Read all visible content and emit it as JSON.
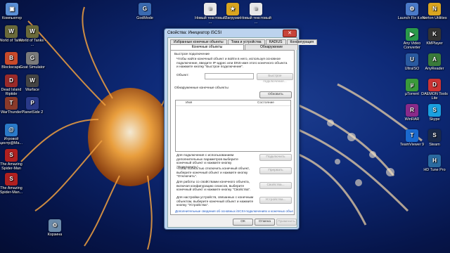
{
  "desktop": {
    "icons_left": [
      {
        "label": "Компьютер",
        "glyph": "▣",
        "color": "#5a8fd6"
      },
      {
        "label": "World of Tanks",
        "glyph": "W",
        "color": "#6a6a3a"
      },
      {
        "label": "World of Tanks - ...",
        "glyph": "W",
        "color": "#6a6a3a"
      },
      {
        "label": "Blockscape",
        "glyph": "B",
        "color": "#c94a2a"
      },
      {
        "label": "Goat Simulator",
        "glyph": "G",
        "color": "#7a7a7a"
      },
      {
        "label": "Dead Island Riptide",
        "glyph": "D",
        "color": "#9a2a2a"
      },
      {
        "label": "Warface",
        "glyph": "W",
        "color": "#444444"
      },
      {
        "label": "WarThunder",
        "glyph": "T",
        "color": "#8a3a2a"
      },
      {
        "label": "PlanetSide 2",
        "glyph": "P",
        "color": "#2a3a8a"
      },
      {
        "label": "Игровой центр@Ma...",
        "glyph": "@",
        "color": "#2a7ac9"
      },
      {
        "label": "The Amazing Spider-Man",
        "glyph": "S",
        "color": "#b02020"
      },
      {
        "label": "The Amazing Spider-Man...",
        "glyph": "S",
        "color": "#b02020"
      },
      {
        "label": "Корзина",
        "glyph": "♲",
        "color": "#6a8aaa"
      }
    ],
    "icons_top": [
      {
        "label": "GodMode",
        "glyph": "G",
        "color": "#3a6ab0"
      },
      {
        "label": "Новый текстовый ...",
        "glyph": "≡",
        "color": "#e8e8e8"
      },
      {
        "label": "Загрузки",
        "glyph": "★",
        "color": "#d9a520"
      },
      {
        "label": "Новый текстовый ...",
        "glyph": "≡",
        "color": "#e8e8e8"
      }
    ],
    "icons_right": [
      {
        "label": "Launch Fix it.exe",
        "glyph": "⚙",
        "color": "#4a7ac9"
      },
      {
        "label": "Norton Utilities",
        "glyph": "N",
        "color": "#d9a520"
      },
      {
        "label": "Any Video Converter",
        "glyph": "▶",
        "color": "#2a9a4a"
      },
      {
        "label": "KMPlayer",
        "glyph": "K",
        "color": "#333333"
      },
      {
        "label": "UltraISO",
        "glyph": "U",
        "color": "#2a5aa0"
      },
      {
        "label": "AnyReader",
        "glyph": "A",
        "color": "#3a7a3a"
      },
      {
        "label": "µTorrent",
        "glyph": "µ",
        "color": "#3a9a3a"
      },
      {
        "label": "DAEMON Tools Lite",
        "glyph": "D",
        "color": "#cc3333"
      },
      {
        "label": "WinRAR",
        "glyph": "R",
        "color": "#8a2a8a"
      },
      {
        "label": "Skype",
        "glyph": "S",
        "color": "#1aa0e0"
      },
      {
        "label": "TeamViewer 9",
        "glyph": "T",
        "color": "#1a6ad0"
      },
      {
        "label": "Steam",
        "glyph": "S",
        "color": "#1a2a4a"
      },
      {
        "label": "HD Tune Pro",
        "glyph": "H",
        "color": "#2a6aa0"
      }
    ]
  },
  "dialog": {
    "title": "Свойства: Инициатор iSCSI",
    "close_glyph": "✕",
    "tabs_row1": [
      "Избранные конечные объекты",
      "Тома и устройства",
      "RADIUS",
      "Конфигурация"
    ],
    "tabs_row2": [
      "Конечные объекты",
      "Обнаружение"
    ],
    "quick_connect_heading": "Быстрое подключение",
    "quick_connect_text": "Чтобы найти конечный объект и войти в него, используя основное подключение, введите IP-адрес или DNS-имя этого конечного объекта и нажмите кнопку \"Быстрое подключение\".",
    "target_label": "Объект:",
    "target_value": "",
    "quick_connect_button": "Быстрое подключение...",
    "discovered_heading": "Обнаруженные конечные объекты",
    "refresh_button": "Обновить",
    "col_name": "Имя",
    "col_status": "Состояние",
    "connect_text": "Для подключения с использованием дополнительных параметров выберите конечный объект и нажмите кнопку \"Подключить\".",
    "connect_button": "Подключить",
    "disconnect_text": "Чтобы полностью отключить конечный объект, выберите конечный объект и нажмите кнопку \"Отключить\".",
    "disconnect_button": "Прервать",
    "properties_text": "Для работы со свойствами конечного объекта, включая конфигурацию сеансов, выберите конечный объект и нажмите кнопку \"Свойства\".",
    "properties_button": "Свойства...",
    "devices_text": "Для настройки устройств, связанных с конечным объектом, выберите конечный объект и нажмите кнопку \"Устройства\".",
    "devices_button": "Устройства...",
    "more_info_link": "Дополнительные сведения об основных iSCSI-подключениях и конечных объектах",
    "ok_button": "ОК",
    "cancel_button": "Отмена",
    "apply_button": "Применить"
  }
}
